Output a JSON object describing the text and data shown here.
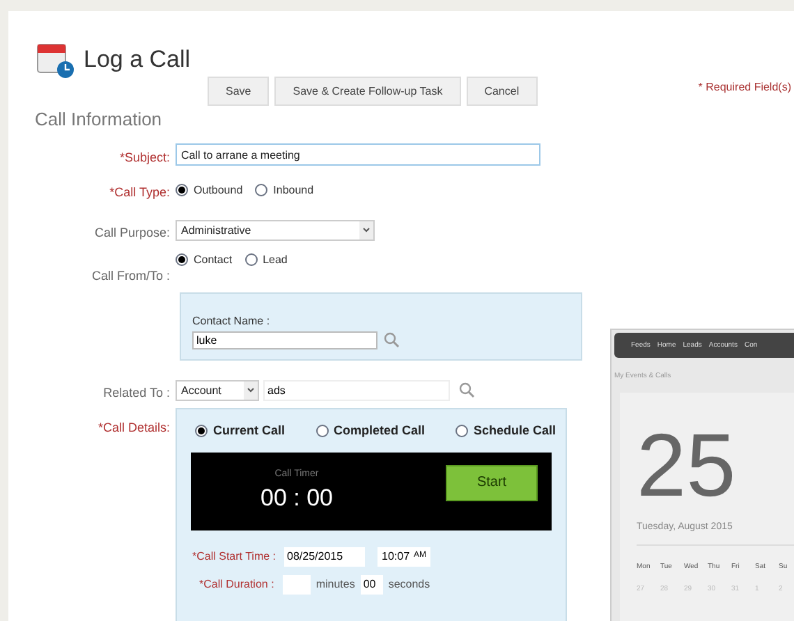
{
  "header": {
    "title": "Log a Call"
  },
  "buttons": [
    "Save",
    "Save & Create Follow-up Task",
    "Cancel"
  ],
  "required_note": "* Required Field(s)",
  "section_title": "Call Information",
  "subject": {
    "label": "*Subject:",
    "value": "Call to arrane a meeting"
  },
  "call_type": {
    "label": "*Call Type:",
    "options": [
      {
        "label": "Outbound",
        "selected": true
      },
      {
        "label": "Inbound",
        "selected": false
      }
    ]
  },
  "call_purpose": {
    "label": "Call Purpose:",
    "value": "Administrative"
  },
  "call_from_to": {
    "label": "Call From/To :",
    "options": [
      {
        "label": "Contact",
        "selected": true
      },
      {
        "label": "Lead",
        "selected": false
      }
    ]
  },
  "contact_name": {
    "label": "Contact Name :",
    "value": "luke"
  },
  "related_to": {
    "label": "Related To :",
    "type": "Account",
    "value": "ads"
  },
  "call_details": {
    "label": "*Call Details:",
    "options": [
      {
        "label": "Current Call",
        "selected": true
      },
      {
        "label": "Completed Call",
        "selected": false
      },
      {
        "label": "Schedule Call",
        "selected": false
      }
    ],
    "timer_label": "Call Timer",
    "timer": "00 : 00",
    "start": "Start",
    "start_time_label": "*Call Start Time :",
    "date": "08/25/2015",
    "time": "10:07",
    "ampm": "AM",
    "duration_label": "*Call Duration :",
    "minutes_label": "minutes",
    "seconds": "00",
    "seconds_label": "seconds"
  },
  "background_app": {
    "nav": [
      "Feeds",
      "Home",
      "Leads",
      "Accounts",
      "Con"
    ],
    "subtitle": "My Events & Calls",
    "day": "25",
    "date": "Tuesday, August 2015",
    "weekdays": [
      "Mon",
      "Tue",
      "Wed",
      "Thu",
      "Fri",
      "Sat",
      "Su"
    ],
    "days": [
      "27",
      "28",
      "29",
      "30",
      "31",
      "1",
      "2"
    ]
  }
}
